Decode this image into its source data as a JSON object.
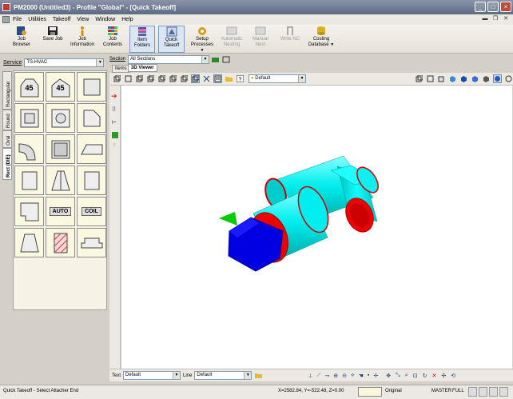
{
  "window": {
    "title": "PM2000 (Untitled3) - Profile \"Global\" - [Quick Takeoff]"
  },
  "menu": [
    "File",
    "Utilities",
    "Takeoff",
    "View",
    "Window",
    "Help"
  ],
  "toolbar": [
    {
      "label1": "Job",
      "label2": "Browser",
      "icon": "job-browser-icon"
    },
    {
      "label1": "Save Job",
      "label2": "",
      "icon": "save-icon"
    },
    {
      "label1": "Job",
      "label2": "Information",
      "icon": "info-icon"
    },
    {
      "label1": "Job",
      "label2": "Contents",
      "icon": "grid-icon"
    },
    {
      "label1": "Item",
      "label2": "Folders",
      "icon": "folders-icon"
    },
    {
      "label1": "Quick",
      "label2": "Takeoff",
      "icon": "quick-takeoff-icon"
    },
    {
      "label1": "Setup",
      "label2": "Processes",
      "icon": "setup-icon"
    },
    {
      "label1": "Automatic",
      "label2": "Nesting",
      "icon": "nesting-icon"
    },
    {
      "label1": "Manual",
      "label2": "Nest",
      "icon": "manual-nest-icon"
    },
    {
      "label1": "Write NC",
      "label2": "",
      "icon": "write-nc-icon"
    },
    {
      "label1": "Costing",
      "label2": "Database",
      "icon": "costing-icon"
    }
  ],
  "left": {
    "service_label": "Service",
    "service_value": "TS-HVAC",
    "tabs": [
      "Rectangular",
      "Round",
      "Oval",
      "Rect (DIE)"
    ],
    "cells": [
      "45",
      "45",
      "",
      "",
      "",
      "",
      "",
      "",
      "",
      "",
      "",
      "",
      "",
      "AUTO",
      "COIL",
      "",
      "",
      ""
    ]
  },
  "main": {
    "section_label": "Section",
    "section_value": "All Sections",
    "tabs": [
      "Items",
      "3D Viewer"
    ],
    "lighting": "Default",
    "bottom": {
      "text_label": "Text",
      "text_value": "Default",
      "line_label": "Line",
      "line_value": "Default"
    }
  },
  "status": {
    "message": "Quick Takeoff - Select Attacher End",
    "coords": "X=2582.84, Y=-522.48, Z=0.00",
    "mode": "Original",
    "master": "MASTER",
    "full": "FULL"
  },
  "colors": {
    "titlebar": "#6b7690",
    "duct": "#00e5e5",
    "flange": "#e00000",
    "endcap": "#0000e0",
    "arrow": "#00c000"
  }
}
